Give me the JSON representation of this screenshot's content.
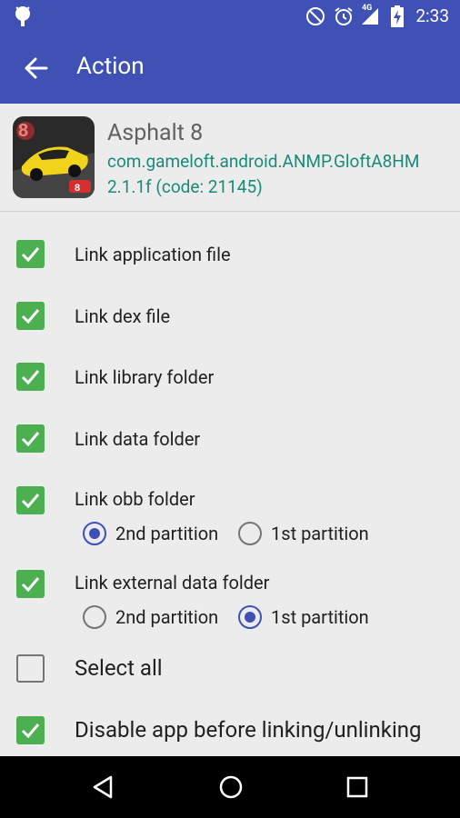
{
  "status": {
    "time": "2:33",
    "network": "4G"
  },
  "appbar": {
    "title": "Action"
  },
  "app": {
    "name": "Asphalt 8",
    "package": "com.gameloft.android.ANMP.GloftA8HM",
    "version": "2.1.1f (code: 21145)"
  },
  "options": [
    {
      "label": "Link application file",
      "checked": true
    },
    {
      "label": "Link dex file",
      "checked": true
    },
    {
      "label": "Link library folder",
      "checked": true
    },
    {
      "label": "Link data folder",
      "checked": true
    },
    {
      "label": "Link obb folder",
      "checked": true
    },
    {
      "label": "Link external data folder",
      "checked": true
    },
    {
      "label": "Select all",
      "checked": false
    },
    {
      "label": "Disable app before linking/unlinking",
      "checked": true
    }
  ],
  "partitions": {
    "obb": {
      "opt1": "2nd partition",
      "opt2": "1st partition",
      "selected": "2nd partition"
    },
    "external": {
      "opt1": "2nd partition",
      "opt2": "1st partition",
      "selected": "1st partition"
    }
  },
  "colors": {
    "primary": "#3f51b5",
    "checkbox": "#4caf50",
    "package_text": "#1a8a7a"
  }
}
